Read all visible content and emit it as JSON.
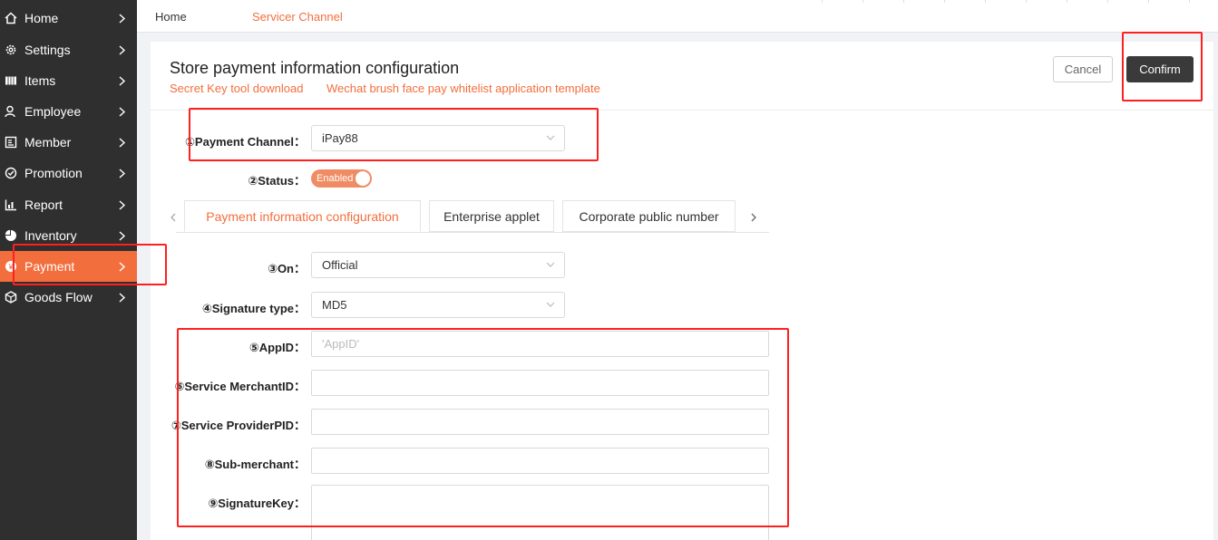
{
  "sidebar": {
    "items": [
      {
        "label": "Home",
        "icon": "home-icon"
      },
      {
        "label": "Settings",
        "icon": "gear-icon"
      },
      {
        "label": "Items",
        "icon": "items-icon"
      },
      {
        "label": "Employee",
        "icon": "employee-icon"
      },
      {
        "label": "Member",
        "icon": "member-icon"
      },
      {
        "label": "Promotion",
        "icon": "promotion-icon"
      },
      {
        "label": "Report",
        "icon": "report-icon"
      },
      {
        "label": "Inventory",
        "icon": "inventory-icon"
      },
      {
        "label": "Payment",
        "icon": "payment-icon",
        "active": true
      },
      {
        "label": "Goods Flow",
        "icon": "goods-flow-icon"
      }
    ]
  },
  "breadcrumb": {
    "home": "Home",
    "current": "Servicer Channel"
  },
  "panel": {
    "title": "Store payment information configuration",
    "links": [
      "Secret Key tool download",
      "Wechat brush face pay whitelist application template"
    ],
    "cancel_label": "Cancel",
    "confirm_label": "Confirm"
  },
  "form": {
    "payment_channel": {
      "label": "①Payment Channel：",
      "value": "iPay88"
    },
    "status": {
      "label": "②Status：",
      "value": "Enabled"
    },
    "tabs": [
      "Payment information configuration",
      "Enterprise applet",
      "Corporate public number"
    ],
    "on": {
      "label": "③On：",
      "value": "Official"
    },
    "signature_type": {
      "label": "④Signature type：",
      "value": "MD5"
    },
    "app_id": {
      "label": "⑤AppID：",
      "placeholder": "'AppID'"
    },
    "service_merchant_id": {
      "label": "⑥Service MerchantID：",
      "value": ""
    },
    "service_provider_pid": {
      "label": "⑦Service ProviderPID：",
      "value": ""
    },
    "sub_merchant": {
      "label": "⑧Sub-merchant：",
      "value": ""
    },
    "signature_key": {
      "label": "⑨SignatureKey：",
      "value": ""
    }
  },
  "colors": {
    "accent": "#f36e3d",
    "sidebar_bg": "#2f2f2f",
    "annotation": "#ff1f1f",
    "confirm_bg": "#3a3a3a"
  }
}
